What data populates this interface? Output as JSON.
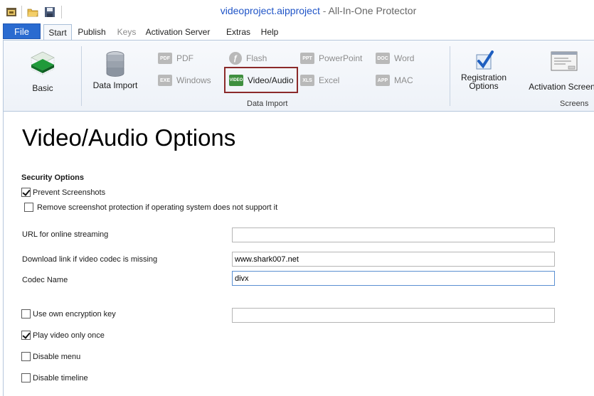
{
  "window": {
    "file_name": "videoproject.aipproject",
    "separator": "-",
    "app_name": "All-In-One Protector"
  },
  "menu": {
    "file": "File",
    "tabs": [
      "Start",
      "Publish",
      "Keys",
      "Activation Server",
      "Extras",
      "Help"
    ],
    "active_tab": "Start"
  },
  "ribbon": {
    "basic": "Basic",
    "data_import": "Data Import",
    "pdf": "PDF",
    "windows": "Windows",
    "flash": "Flash",
    "video_audio": "Video/Audio",
    "powerpoint": "PowerPoint",
    "excel": "Excel",
    "word": "Word",
    "mac": "MAC",
    "group_data_import": "Data Import",
    "registration_options_1": "Registration",
    "registration_options_2": "Options",
    "activation_screens": "Activation Screens",
    "group_screens": "Screens",
    "icon_tags": {
      "pdf": "PDF",
      "exe": "EXE",
      "video": "VIDEO",
      "ppt": "PPT",
      "xls": "XLS",
      "doc": "DOC",
      "app": "APP"
    }
  },
  "page": {
    "title": "Video/Audio Options",
    "security_options": "Security Options",
    "prevent_screenshots": "Prevent Screenshots",
    "prevent_screenshots_checked": true,
    "remove_protection": "Remove screenshot protection if operating system does not support it",
    "remove_protection_checked": false,
    "url_streaming_label": "URL for online streaming",
    "url_streaming_value": "",
    "download_link_label": "Download link if video codec is missing",
    "download_link_value": "www.shark007.net",
    "codec_name_label": "Codec Name",
    "codec_name_value": "divx",
    "own_key_label": "Use own encryption key",
    "own_key_checked": false,
    "own_key_value": "",
    "play_once_label": "Play video only once",
    "play_once_checked": true,
    "disable_menu_label": "Disable menu",
    "disable_menu_checked": false,
    "disable_timeline_label": "Disable timeline",
    "disable_timeline_checked": false
  },
  "colors": {
    "accent": "#2a6bd0",
    "title_file": "#1f54c7",
    "highlight": "#8b2a2a"
  }
}
